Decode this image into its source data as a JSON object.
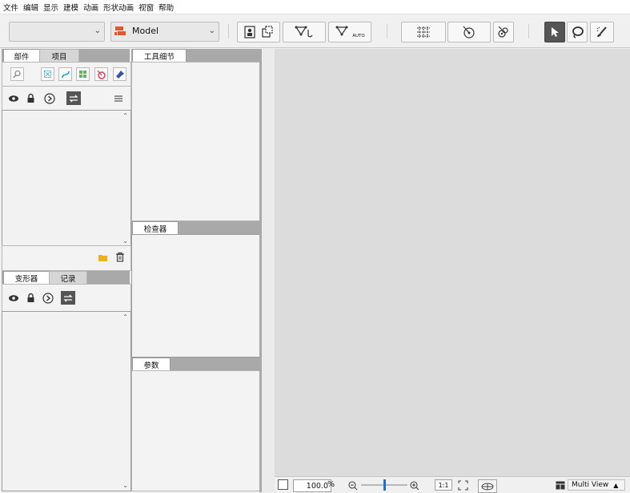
{
  "menu": [
    "文件",
    "编辑",
    "显示",
    "建模",
    "动画",
    "形状动画",
    "视窗",
    "帮助"
  ],
  "toolbar": {
    "first_combo_value": "",
    "model_combo_value": "Model",
    "icons": [
      "part-person-icon",
      "layer-icon",
      "mesh-edit-icon",
      "mesh-edit-b-icon",
      "auto-mesh-icon",
      "deform-grid-icon",
      "rotation-deformer-icon",
      "glue-icon",
      "select-arrow-icon",
      "lasso-icon",
      "brush-icon"
    ],
    "auto_label": "AUTO"
  },
  "left_top_panel": {
    "tabs": [
      "部件",
      "项目"
    ],
    "icons": [
      "search-icon",
      "select-icon",
      "curve-icon",
      "grid-icon",
      "target-icon",
      "pin-icon"
    ],
    "row_icons": [
      "eye-icon",
      "lock-icon",
      "circle-arrow-icon",
      "swap-icon",
      "menu-icon"
    ],
    "bottom_icons": [
      "folder-icon",
      "trash-icon"
    ]
  },
  "left_bottom_panel": {
    "tabs": [
      "变形器",
      "记录"
    ],
    "row_icons": [
      "eye-icon",
      "lock-icon",
      "circle-arrow-icon",
      "swap-icon"
    ]
  },
  "middle_panels": {
    "tool_detail_tab": "工具细节",
    "inspector_tab": "检查器",
    "params_tab": "参数"
  },
  "statusbar": {
    "zoom_value": "100.0",
    "zoom_unit": "%",
    "zoom_slider_level": 0.5,
    "one_to_one": "1:1",
    "view_mode": "Multi View",
    "view_arrow": "▲"
  }
}
